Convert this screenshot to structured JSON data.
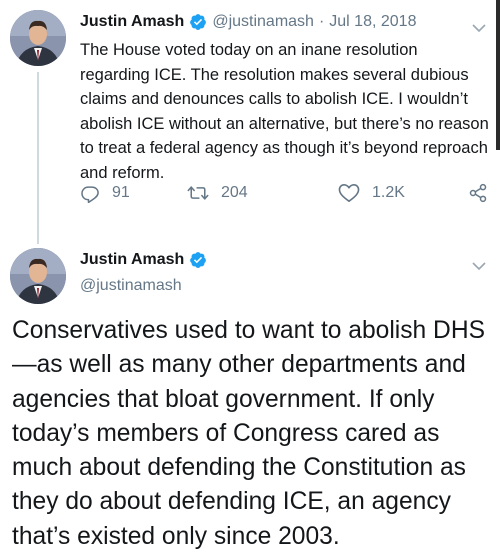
{
  "colors": {
    "text_primary": "#14171a",
    "text_secondary": "#657786",
    "verified_blue": "#1da1f2",
    "thread_line": "#cfd9de"
  },
  "tweet_reply_context": {
    "author_name": "Justin Amash",
    "handle": "@justinamash",
    "separator": "·",
    "date": "Jul 18, 2018",
    "text": "The House voted today on an inane resolution regarding ICE. The resolution makes several dubious claims and denounces calls to abolish ICE. I wouldn’t abolish ICE without an alternative, but there’s no reason to treat a federal agency as though it’s beyond reproach and reform.",
    "icons": {
      "verified": "verified-badge-icon",
      "more": "chevron-down-icon",
      "reply": "reply-icon",
      "retweet": "retweet-icon",
      "like": "heart-icon",
      "share": "share-icon"
    },
    "stats": {
      "replies": "91",
      "retweets": "204",
      "likes": "1.2K"
    }
  },
  "tweet_main": {
    "author_name": "Justin Amash",
    "handle": "@justinamash",
    "text": "Conservatives used to want to abolish DHS—as well as many other departments and agencies that bloat government. If only today’s members of Congress cared as much about defending the Constitution as they do about defending ICE, an agency that’s existed only since 2003.",
    "icons": {
      "verified": "verified-badge-icon",
      "more": "chevron-down-icon"
    }
  }
}
